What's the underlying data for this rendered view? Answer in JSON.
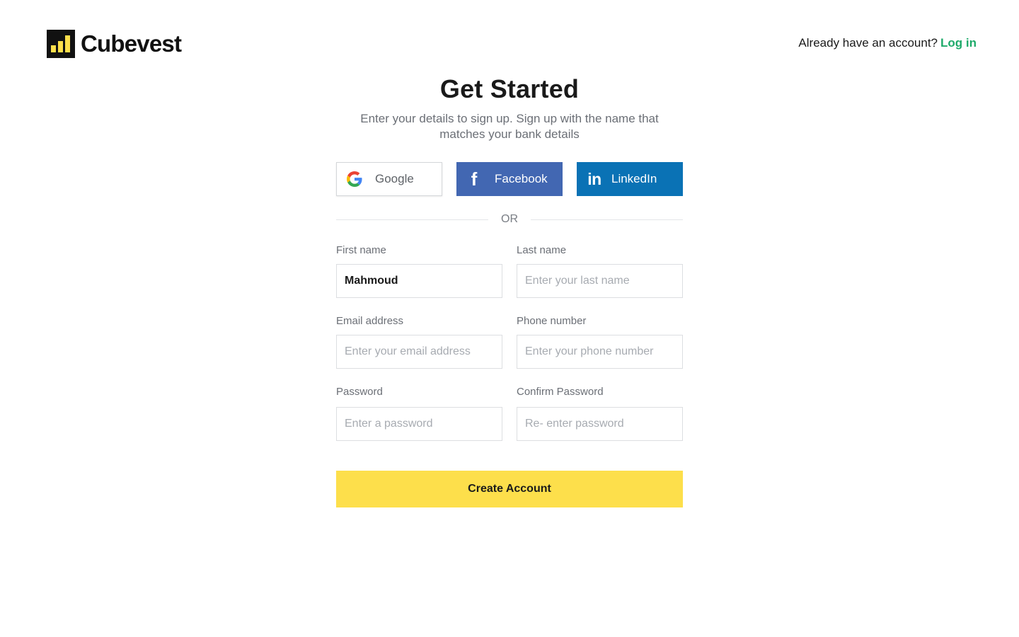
{
  "brand": {
    "name": "Cubevest",
    "logo_bar_color": "#fddf4b"
  },
  "header": {
    "login_prompt": "Already have an account?",
    "login_link": "Log in",
    "login_link_color": "#1eaa6a"
  },
  "title": "Get Started",
  "subtitle": "Enter your details to sign up. Sign up  with the name that matches your bank details",
  "social": {
    "google": {
      "label": "Google",
      "icon": "google-icon"
    },
    "facebook": {
      "label": "Facebook",
      "icon": "facebook-icon",
      "color": "#4267b2"
    },
    "linkedin": {
      "label": "LinkedIn",
      "icon": "linkedin-icon",
      "color": "#0a72b5"
    }
  },
  "divider_text": "OR",
  "form": {
    "first_name": {
      "label": "First name",
      "value": "Mahmoud",
      "placeholder": ""
    },
    "last_name": {
      "label": "Last name",
      "value": "",
      "placeholder": "Enter your last name"
    },
    "email": {
      "label": "Email address",
      "value": "",
      "placeholder": "Enter your email address"
    },
    "phone": {
      "label": "Phone number",
      "value": "",
      "placeholder": "Enter your phone number"
    },
    "password": {
      "label": "Password",
      "value": "",
      "placeholder": "Enter a password"
    },
    "confirm_password": {
      "label": "Confirm Password",
      "value": "",
      "placeholder": "Re- enter password"
    }
  },
  "submit_label": "Create Account",
  "submit_color": "#fddf4b"
}
